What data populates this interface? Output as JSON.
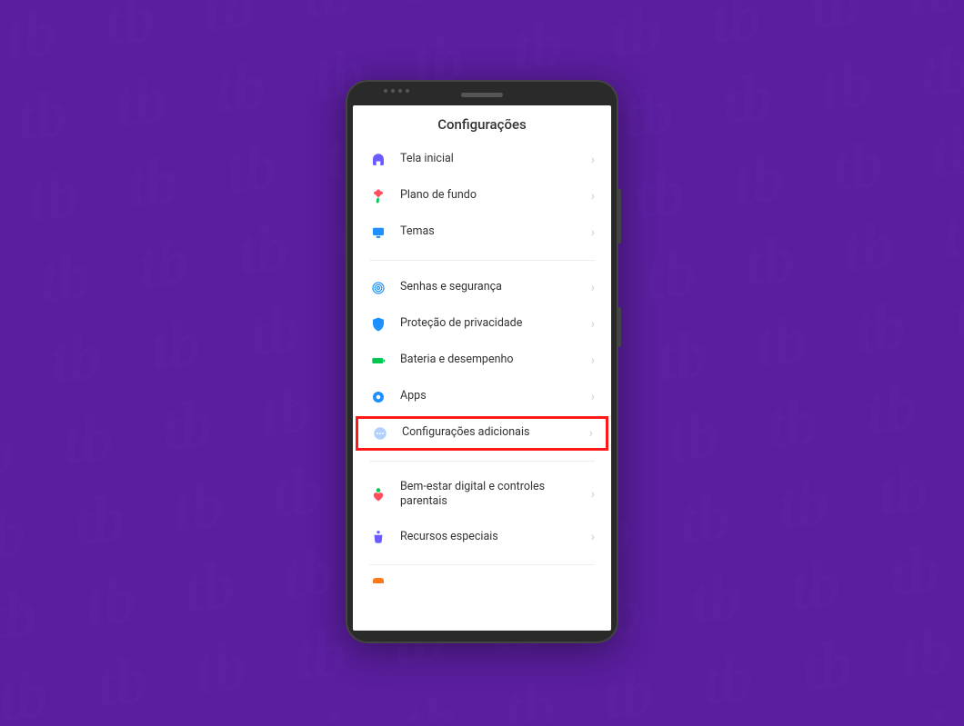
{
  "app_title": "Configurações",
  "sections": [
    {
      "items": [
        {
          "id": "home",
          "icon": "home-icon",
          "color": "#6b5cff",
          "label": "Tela inicial"
        },
        {
          "id": "wallpaper",
          "icon": "flower-icon",
          "color": "#ff4d5e",
          "label": "Plano de fundo"
        },
        {
          "id": "themes",
          "icon": "theme-icon",
          "color": "#1e90ff",
          "label": "Temas"
        }
      ]
    },
    {
      "items": [
        {
          "id": "security",
          "icon": "fingerprint-icon",
          "color": "#1e90ff",
          "label": "Senhas e segurança"
        },
        {
          "id": "privacy",
          "icon": "shield-icon",
          "color": "#1e90ff",
          "label": "Proteção de privacidade"
        },
        {
          "id": "battery",
          "icon": "battery-icon",
          "color": "#00c853",
          "label": "Bateria e desempenho"
        },
        {
          "id": "apps",
          "icon": "gear-icon",
          "color": "#1e90ff",
          "label": "Apps"
        },
        {
          "id": "additional",
          "icon": "dots-icon",
          "color": "#b3d1ff",
          "label": "Configurações adicionais",
          "highlighted": true
        }
      ]
    },
    {
      "items": [
        {
          "id": "wellbeing",
          "icon": "heart-person-icon",
          "color": "#00c853",
          "label": "Bem-estar digital e controles parentais"
        },
        {
          "id": "special",
          "icon": "bag-icon",
          "color": "#6b5cff",
          "label": "Recursos especiais"
        }
      ]
    }
  ]
}
